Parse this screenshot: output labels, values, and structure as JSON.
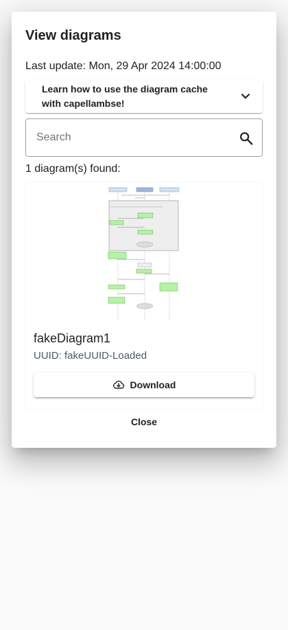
{
  "dialog": {
    "title": "View diagrams",
    "last_update": "Last update: Mon, 29 Apr 2024 14:00:00",
    "help_panel": {
      "label": "Learn how to use the diagram cache with capellambse!",
      "icon": "chevron-down-icon"
    },
    "search": {
      "placeholder": "Search",
      "value": "",
      "icon": "search-icon"
    },
    "results_count": "1 diagram(s) found:",
    "diagrams": [
      {
        "name": "fakeDiagram1",
        "uuid": "UUID: fakeUUID-Loaded",
        "download_label": "Download",
        "download_icon": "cloud-download-icon"
      }
    ],
    "close_label": "Close"
  },
  "colors": {
    "lifeline_header": "#cfe2f3",
    "activation_green": "#b6f2a4",
    "frame_gray": "#eeeeee",
    "text": "#212121",
    "uuid_text": "#4a5a6a"
  }
}
